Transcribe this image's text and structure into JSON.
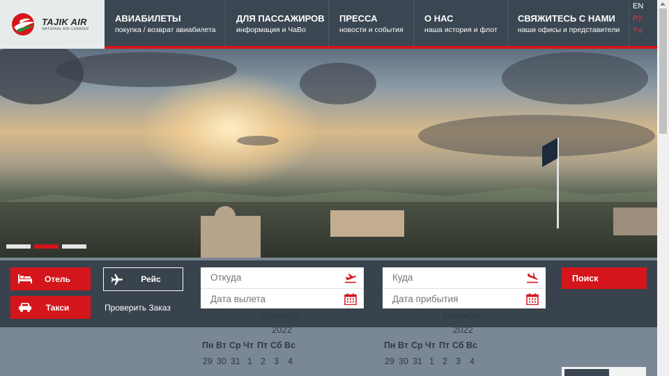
{
  "brand": {
    "name": "TAJIK AIR",
    "tagline": "NATIONAL AIR CARRIER",
    "colors": {
      "accent": "#d4161c",
      "nav_bg": "#3a4651",
      "logo_bg": "#e6ecec"
    }
  },
  "nav": [
    {
      "title": "АВИАБИЛЕТЫ",
      "subtitle": "покупка / возврат авиабилета"
    },
    {
      "title": "ДЛЯ ПАССАЖИРОВ",
      "subtitle": "информация и ЧаВо"
    },
    {
      "title": "ПРЕССА",
      "subtitle": "новости и события"
    },
    {
      "title": "О НАС",
      "subtitle": "наша история и флот"
    },
    {
      "title": "СВЯЖИТЕСЬ С НАМИ",
      "subtitle": "наши офисы и представители"
    }
  ],
  "languages": {
    "en": "EN",
    "ru": "РУ",
    "tg": "ТЧ"
  },
  "slider": {
    "slide_count": 3,
    "active_index": 1
  },
  "booking": {
    "hotel_label": "Отель",
    "taxi_label": "Такси",
    "flight_label": "Рейс",
    "check_order_label": "Проверить Заказ",
    "from_placeholder": "Откуда",
    "departure_date_placeholder": "Дата вылета",
    "to_placeholder": "Куда",
    "arrival_date_placeholder": "Дата прибытия",
    "search_label": "Поиск"
  },
  "calendars": [
    {
      "month": "Сентябрь",
      "year": "2022",
      "weekdays": [
        "Пн",
        "Вт",
        "Ср",
        "Чт",
        "Пт",
        "Сб",
        "Вс"
      ],
      "first_row": [
        "29",
        "30",
        "31",
        "1",
        "2",
        "3",
        "4"
      ]
    },
    {
      "month": "Сентябрь",
      "year": "2022",
      "weekdays": [
        "Пн",
        "Вт",
        "Ср",
        "Чт",
        "Пт",
        "Сб",
        "Вс"
      ],
      "first_row": [
        "29",
        "30",
        "31",
        "1",
        "2",
        "3",
        "4"
      ]
    }
  ]
}
